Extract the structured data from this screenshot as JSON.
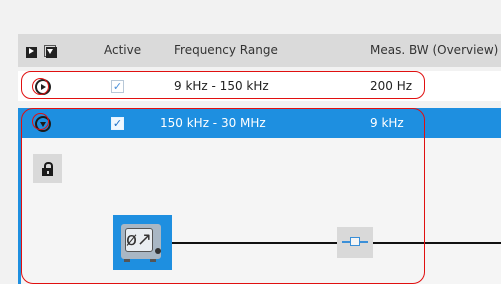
{
  "table": {
    "columns": {
      "active": "Active",
      "frequency_range": "Frequency Range",
      "meas_bw": "Meas. BW (Overview)"
    },
    "rows": [
      {
        "active": true,
        "frequency_range": "9 kHz - 150 kHz",
        "meas_bw": "200 Hz",
        "expanded": false,
        "selected": false
      },
      {
        "active": true,
        "frequency_range": "150 kHz - 30 MHz",
        "meas_bw": "9 kHz",
        "expanded": true,
        "selected": true
      }
    ]
  },
  "checkmark": "✓",
  "detail": {
    "lock_icon": "lock-icon",
    "device_symbol": "ø↗",
    "filter_icon": "filter-icon"
  },
  "colors": {
    "selection": "#1e8fe0",
    "header_bg": "#dadada",
    "highlight": "#e01010"
  }
}
